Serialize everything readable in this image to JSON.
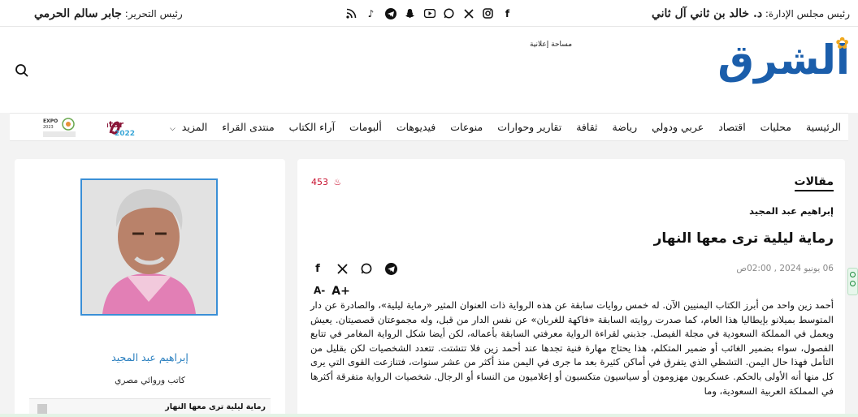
{
  "topbar": {
    "chair_label": "رئيس مجلس الإدارة:",
    "chair_name": "د. خالد بن ثاني آل ثاني",
    "editor_label": "رئيس التحرير:",
    "editor_name": "جابر سالم الحرمي",
    "social_icons": [
      "facebook-icon",
      "instagram-icon",
      "x-icon",
      "whatsapp-icon",
      "youtube-icon",
      "snapchat-icon",
      "telegram-icon",
      "tiktok-icon",
      "rss-icon"
    ]
  },
  "header": {
    "ad_label": "مساحة إعلانية",
    "logo_text": "الشرق"
  },
  "nav": {
    "items": [
      "الرئيسية",
      "محليات",
      "اقتصاد",
      "عربي ودولي",
      "رياضة",
      "ثقافة",
      "تقارير وحوارات",
      "منوعات",
      "فيديوهات",
      "ألبومات",
      "آراء الكتاب",
      "منتدى القراء",
      "المزيد"
    ],
    "qatar_logo": "Qatar 2022",
    "expo_logo": "EXPO 2023"
  },
  "article": {
    "section": "مقالات",
    "views": "453",
    "author": "إبراهيم عبد المجيد",
    "title": "رماية ليلية ترى معها النهار",
    "date": "06 يونيو 2024 , 02:00ص",
    "font_smaller": "A-",
    "font_larger": "A+",
    "body": "أحمد زين واحد من أبرز الكتاب اليمنيين الآن. له خمس روايات سابقة عن هذه الرواية ذات العنوان المثير «رماية ليلية»، والصادرة عن دار المتوسط بميلانو بإيطاليا هذا العام، كما صدرت روايته السابقة «فاكهة للغربان» عن نفس الدار من قبل، وله مجموعتان قصصيتان. يعيش ويعمل في المملكة السعودية في مجلة الفيصل. جذبني لقراءة الرواية معرفتي السابقة بأعماله، لكن أيضا شكل الرواية المغامر في تتابع الفصول، سواء بضمير الغائب أو ضمير المتكلم، هذا يحتاج مهارة فنية تجدها عند أحمد زين فلا تتشتت. تتعدد الشخصيات لكن بقليل من التأمل فهذا حال اليمن. التشظي الذي يتفرق في أماكن كثيرة بعد ما جرى في اليمن منذ أكثر من عشر سنوات، فتنازعت القوى التي يرى كل منها أنه الأولى بالحكم. عسكريون مهزومون أو سياسيون متكسبون أو إعلاميون من النساء أو الرجال. شخصيات الرواية متفرقة أكثرها في المملكة العربية السعودية، وما"
  },
  "sidebar": {
    "author_name": "إبراهيم عبد المجيد",
    "author_role": "كاتب وروائي مصري",
    "card_title": "رماية ليلية ترى معها النهار"
  },
  "colors": {
    "brand_blue": "#1b5eab",
    "accent_red": "#c8102e",
    "link_blue": "#2a7fbf"
  }
}
